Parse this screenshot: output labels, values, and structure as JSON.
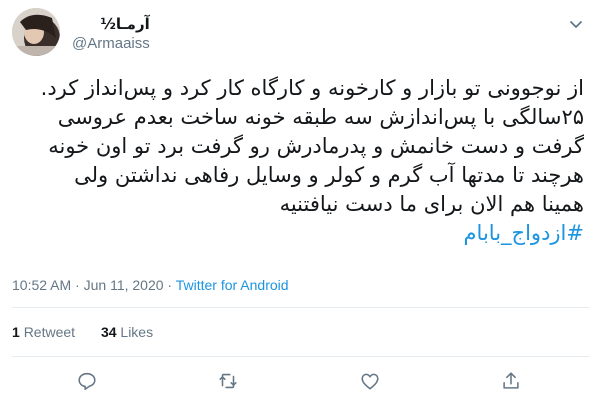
{
  "author": {
    "display_name": "آرمـا½",
    "handle": "@Armaaiss",
    "avatar_icon": "profile-photo"
  },
  "tweet": {
    "lines": [
      "از نوجوونی تو بازار و کارخونه و کارگاه کار کرد و پس‌انداز کرد.",
      "۲۵سالگی با پس‌اندازش سه طبقه خونه ساخت بعدم عروسی",
      "گرفت و دست خانمش و پدرمادرش رو گرفت برد تو اون خونه",
      "هرچند تا مدتها آب گرم و کولر و وسایل رفاهی نداشتن ولی",
      "همینا هم الان برای ما دست نیافتنیه"
    ],
    "hashtag": "#ازدواج_بابام"
  },
  "meta": {
    "time": "10:52 AM",
    "separator1": " · ",
    "date": "Jun 11, 2020",
    "separator2": " · ",
    "source": "Twitter for Android"
  },
  "stats": {
    "retweets_count": "1",
    "retweets_label": "Retweet",
    "likes_count": "34",
    "likes_label": "Likes"
  },
  "actions": {
    "icons": [
      "reply-icon",
      "retweet-icon",
      "like-icon",
      "share-icon"
    ]
  },
  "colors": {
    "link": "#1b95e0",
    "secondary_text": "#657786",
    "primary_text": "#14171a",
    "divider": "#e6ecf0"
  }
}
